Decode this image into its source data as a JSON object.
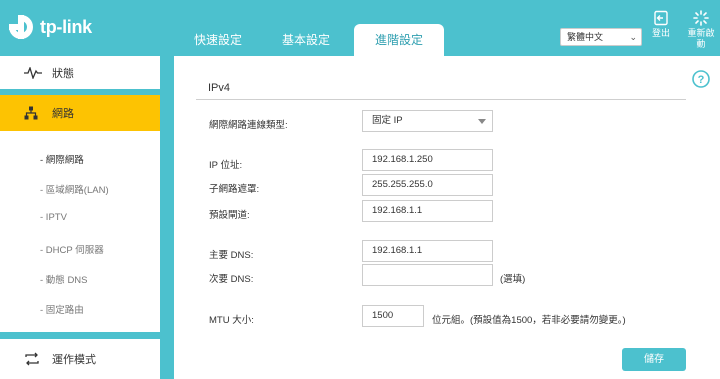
{
  "header": {
    "brand": "tp-link",
    "tabs": [
      {
        "label": "快速設定",
        "active": false
      },
      {
        "label": "基本設定",
        "active": false
      },
      {
        "label": "進階設定",
        "active": true
      }
    ],
    "language": "繁體中文",
    "logout_label": "登出",
    "reboot_label_1": "重新啟",
    "reboot_label_2": "動"
  },
  "sidebar": {
    "status": "狀態",
    "network": "網路",
    "sub_items": [
      "- 網際網路",
      "- 區域網路(LAN)",
      "- IPTV",
      "- DHCP 伺服器",
      "- 動態 DNS",
      "- 固定路由"
    ],
    "active_sub": 0,
    "operation_mode": "運作模式"
  },
  "main": {
    "section": "IPv4",
    "conn_type_label": "網際網路連線類型:",
    "conn_type_value": "固定 IP",
    "ip_label": "IP 位址:",
    "ip_value": "192.168.1.250",
    "mask_label": "子網路遮罩:",
    "mask_value": "255.255.255.0",
    "gateway_label": "預設閘道:",
    "gateway_value": "192.168.1.1",
    "dns1_label": "主要 DNS:",
    "dns1_value": "192.168.1.1",
    "dns2_label": "次要 DNS:",
    "dns2_value": "",
    "optional_note": "(選填)",
    "mtu_label": "MTU 大小:",
    "mtu_value": "1500",
    "mtu_note": "位元組。(預設值為1500，若非必要請勿變更。)",
    "save_label": "儲存"
  },
  "colors": {
    "accent": "#4cc1ce",
    "highlight": "#fdc302"
  }
}
